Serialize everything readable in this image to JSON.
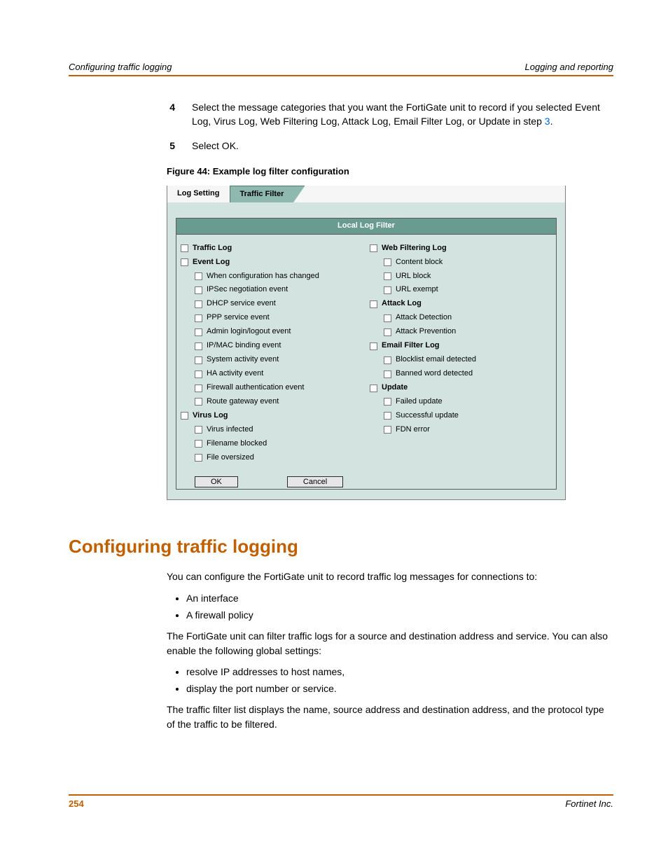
{
  "header": {
    "left": "Configuring traffic logging",
    "right": "Logging and reporting"
  },
  "steps": [
    {
      "num": "4",
      "text_pre": "Select the message categories that you want the FortiGate unit to record if you selected Event Log, Virus Log, Web Filtering Log, Attack Log, Email Filter Log, or Update in step ",
      "link": "3",
      "text_post": "."
    },
    {
      "num": "5",
      "text_pre": "Select OK.",
      "link": "",
      "text_post": ""
    }
  ],
  "figure": {
    "caption": "Figure 44: Example log filter configuration",
    "tabs": {
      "inactive": "Log Setting",
      "active": "Traffic Filter"
    },
    "title": "Local Log Filter",
    "left": [
      {
        "label": "Traffic Log",
        "bold": true,
        "indent": 0
      },
      {
        "label": "Event Log",
        "bold": true,
        "indent": 0
      },
      {
        "label": "When configuration has changed",
        "bold": false,
        "indent": 1
      },
      {
        "label": "IPSec negotiation event",
        "bold": false,
        "indent": 1
      },
      {
        "label": "DHCP service event",
        "bold": false,
        "indent": 1
      },
      {
        "label": "PPP service event",
        "bold": false,
        "indent": 1
      },
      {
        "label": "Admin login/logout event",
        "bold": false,
        "indent": 1
      },
      {
        "label": "IP/MAC binding event",
        "bold": false,
        "indent": 1
      },
      {
        "label": "System activity event",
        "bold": false,
        "indent": 1
      },
      {
        "label": "HA activity event",
        "bold": false,
        "indent": 1
      },
      {
        "label": "Firewall authentication event",
        "bold": false,
        "indent": 1
      },
      {
        "label": "Route gateway event",
        "bold": false,
        "indent": 1
      },
      {
        "label": "Virus Log",
        "bold": true,
        "indent": 0
      },
      {
        "label": "Virus infected",
        "bold": false,
        "indent": 1
      },
      {
        "label": "Filename blocked",
        "bold": false,
        "indent": 1
      },
      {
        "label": "File oversized",
        "bold": false,
        "indent": 1
      }
    ],
    "right": [
      {
        "label": "Web Filtering Log",
        "bold": true,
        "indent": 0
      },
      {
        "label": "Content block",
        "bold": false,
        "indent": 1
      },
      {
        "label": "URL block",
        "bold": false,
        "indent": 1
      },
      {
        "label": "URL exempt",
        "bold": false,
        "indent": 1
      },
      {
        "label": "Attack Log",
        "bold": true,
        "indent": 0
      },
      {
        "label": "Attack Detection",
        "bold": false,
        "indent": 1
      },
      {
        "label": "Attack Prevention",
        "bold": false,
        "indent": 1
      },
      {
        "label": "Email Filter Log",
        "bold": true,
        "indent": 0
      },
      {
        "label": "Blocklist email detected",
        "bold": false,
        "indent": 1
      },
      {
        "label": "Banned word detected",
        "bold": false,
        "indent": 1
      },
      {
        "label": "Update",
        "bold": true,
        "indent": 0
      },
      {
        "label": "Failed update",
        "bold": false,
        "indent": 1
      },
      {
        "label": "Successful update",
        "bold": false,
        "indent": 1
      },
      {
        "label": "FDN error",
        "bold": false,
        "indent": 1
      }
    ],
    "buttons": {
      "ok": "OK",
      "cancel": "Cancel"
    }
  },
  "section": {
    "heading": "Configuring traffic logging",
    "p1": "You can configure the FortiGate unit to record traffic log messages for connections to:",
    "list1": [
      "An interface",
      "A firewall policy"
    ],
    "p2": "The FortiGate unit can filter traffic logs for a source and destination address and service. You can also enable the following global settings:",
    "list2": [
      "resolve IP addresses to host names,",
      "display the port number or service."
    ],
    "p3": "The traffic filter list displays the name, source address and destination address, and the protocol type of the traffic to be filtered."
  },
  "footer": {
    "page": "254",
    "company": "Fortinet Inc."
  }
}
